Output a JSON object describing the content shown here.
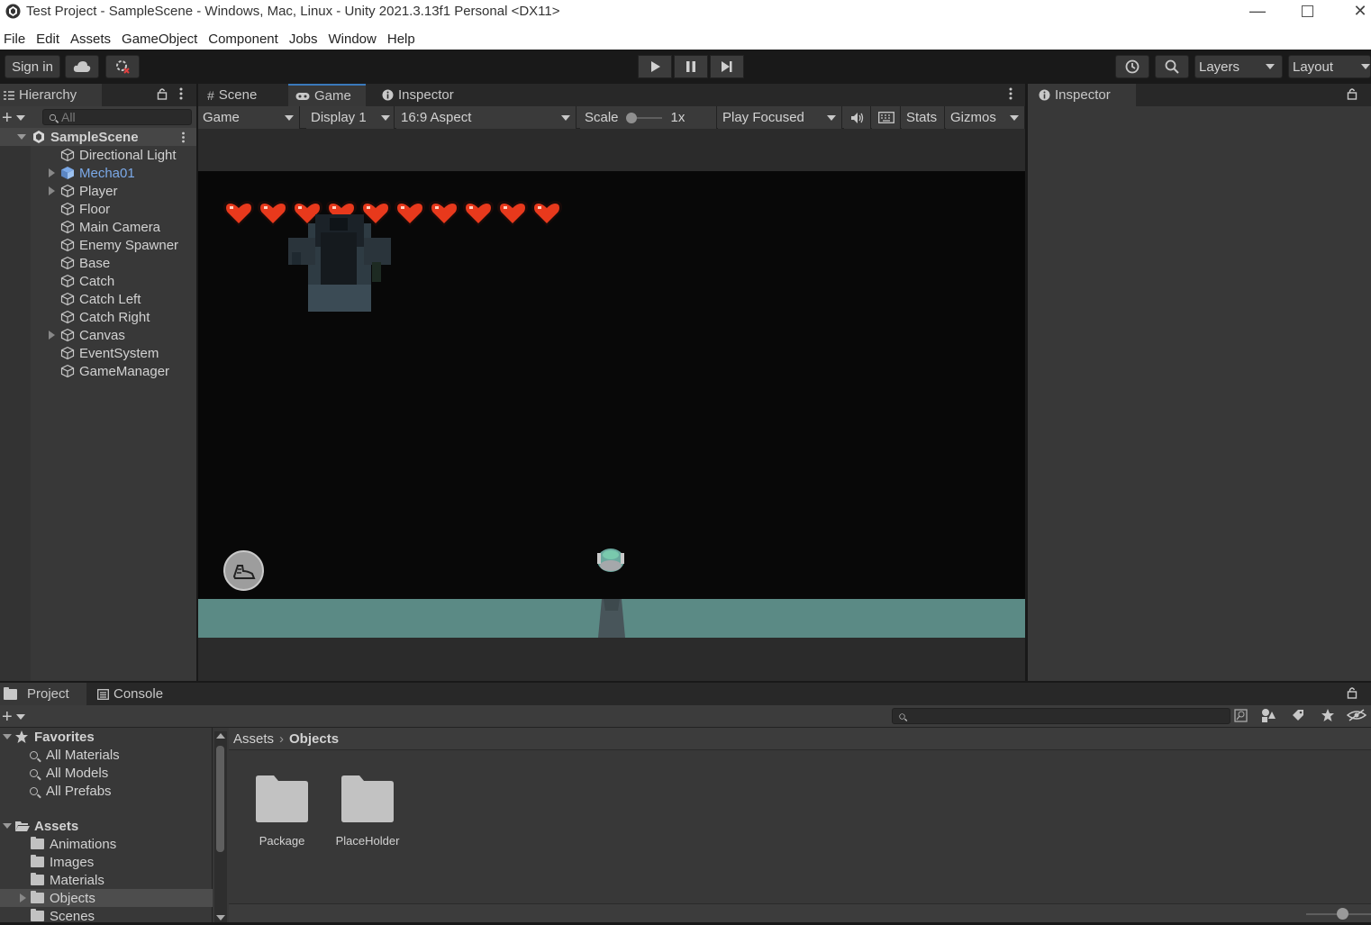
{
  "window": {
    "title": "Test Project - SampleScene - Windows, Mac, Linux - Unity 2021.3.13f1 Personal <DX11>",
    "icons": {
      "minimize": "minimize-icon",
      "maximize": "maximize-icon",
      "close": "close-icon"
    }
  },
  "menu": [
    "File",
    "Edit",
    "Assets",
    "GameObject",
    "Component",
    "Jobs",
    "Window",
    "Help"
  ],
  "toolbar": {
    "sign_in": "Sign in",
    "layers": "Layers",
    "layout": "Layout"
  },
  "hierarchy": {
    "tab": "Hierarchy",
    "search_placeholder": "All",
    "scene": "SampleScene",
    "items": [
      {
        "label": "Directional Light",
        "expandable": false,
        "prefab": false
      },
      {
        "label": "Mecha01",
        "expandable": true,
        "prefab": true
      },
      {
        "label": "Player",
        "expandable": true,
        "prefab": false
      },
      {
        "label": "Floor",
        "expandable": false,
        "prefab": false
      },
      {
        "label": "Main Camera",
        "expandable": false,
        "prefab": false
      },
      {
        "label": "Enemy Spawner",
        "expandable": false,
        "prefab": false
      },
      {
        "label": "Base",
        "expandable": false,
        "prefab": false
      },
      {
        "label": "Catch",
        "expandable": false,
        "prefab": false
      },
      {
        "label": "Catch Left",
        "expandable": false,
        "prefab": false
      },
      {
        "label": "Catch Right",
        "expandable": false,
        "prefab": false
      },
      {
        "label": "Canvas",
        "expandable": true,
        "prefab": false
      },
      {
        "label": "EventSystem",
        "expandable": false,
        "prefab": false
      },
      {
        "label": "GameManager",
        "expandable": false,
        "prefab": false
      }
    ]
  },
  "center_tabs": {
    "scene": "Scene",
    "game": "Game",
    "inspector": "Inspector"
  },
  "game_toolbar": {
    "view": "Game",
    "display": "Display 1",
    "aspect": "16:9 Aspect",
    "scale_label": "Scale",
    "scale_value": "1x",
    "play_mode": "Play Focused",
    "stats": "Stats",
    "gizmos": "Gizmos"
  },
  "game_view": {
    "hearts_count": 10,
    "heart_color": "#e8391c",
    "floor_color": "#5b8a85"
  },
  "inspector": {
    "tab": "Inspector"
  },
  "bottom_tabs": {
    "project": "Project",
    "console": "Console"
  },
  "project": {
    "favorites_label": "Favorites",
    "favorites": [
      "All Materials",
      "All Models",
      "All Prefabs"
    ],
    "assets_label": "Assets",
    "asset_folders": [
      "Animations",
      "Images",
      "Materials",
      "Objects",
      "Scenes"
    ],
    "breadcrumb": [
      "Assets",
      "Objects"
    ],
    "grid_items": [
      "Package",
      "PlaceHolder"
    ]
  },
  "colors": {
    "editor_bg": "#383838",
    "dark_bg": "#191919",
    "selected": "#4d4d4d",
    "prefab_blue": "#7ba9e8"
  }
}
